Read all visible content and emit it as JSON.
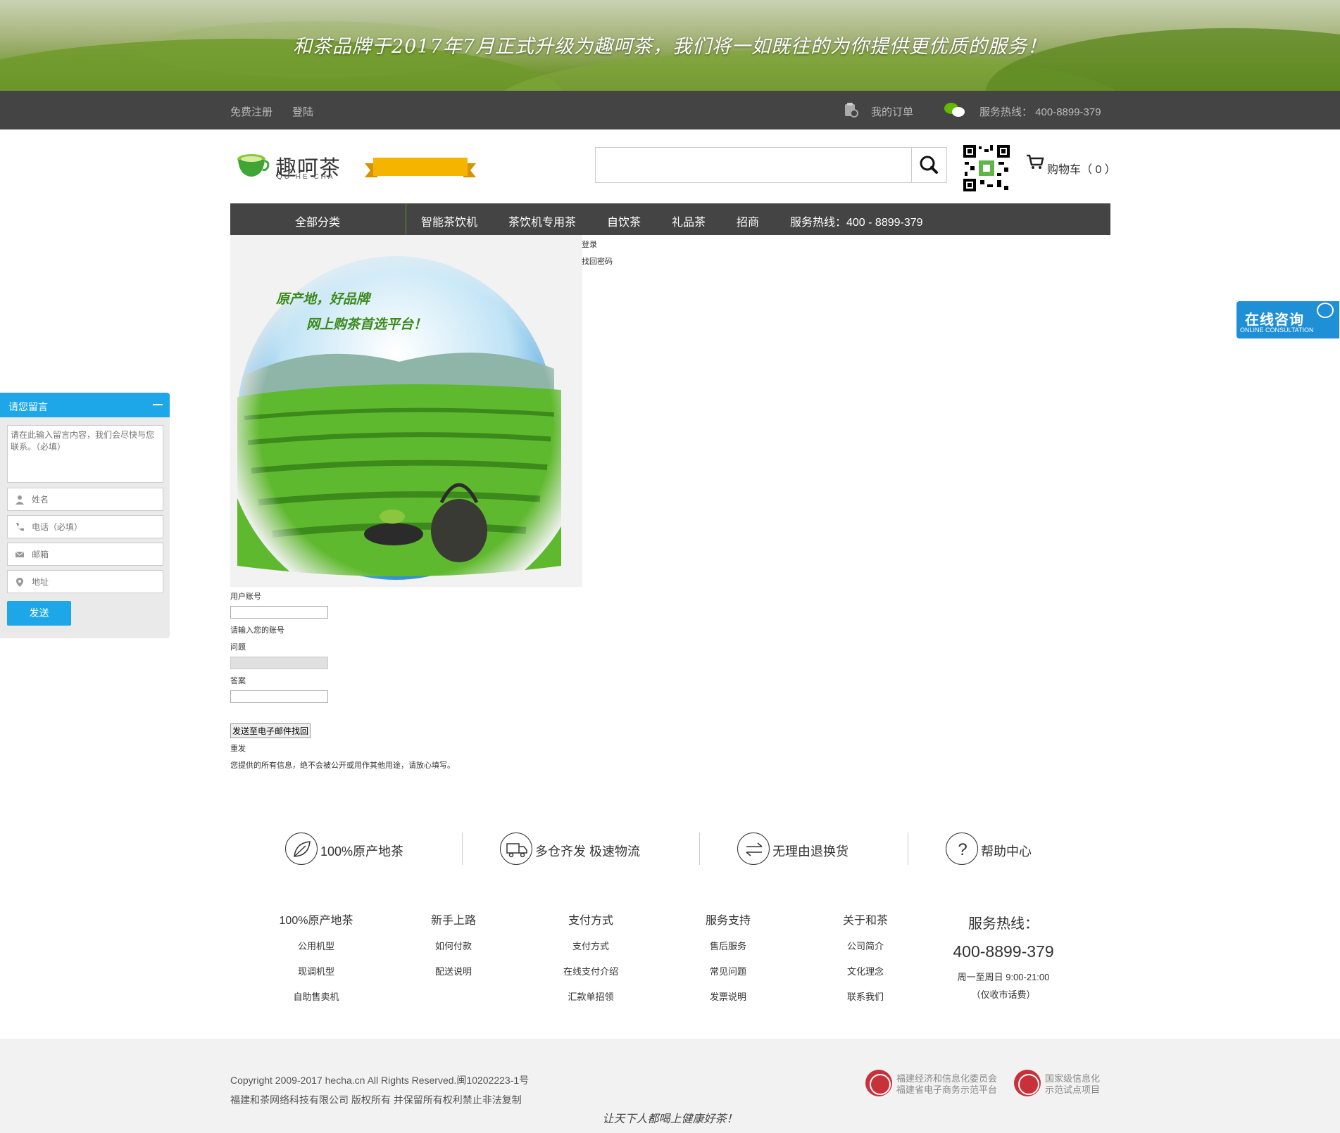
{
  "banner": {
    "slogan": "和茶品牌于2017年7月正式升级为趣呵茶，我们将一如既往的为你提供更优质的服务！"
  },
  "topbar": {
    "register": "免费注册",
    "login": "登陆",
    "my_orders": "我的订单",
    "hotline": "服务热线： 400-8899-379"
  },
  "logo": {
    "name": "趣呵茶",
    "pinyin": "QU HE CHA"
  },
  "search": {
    "placeholder": ""
  },
  "cart": {
    "label": "购物车（ 0 ）"
  },
  "nav": {
    "all": "全部分类",
    "items": [
      "智能茶饮机",
      "茶饮机专用茶",
      "自饮茶",
      "礼品茶",
      "招商",
      "服务热线：400 - 8899-379"
    ]
  },
  "hero": {
    "line1": "原产地，好品牌",
    "line2": "网上购茶首选平台！"
  },
  "login_links": {
    "login": "登录",
    "find_password": "找回密码"
  },
  "form": {
    "account_label": "用户账号",
    "account_hint": "请输入您的账号",
    "question_label": "问题",
    "answer_label": "答案",
    "send_email": "发送至电子邮件找回",
    "resend": "重发",
    "privacy": "您提供的所有信息，绝不会被公开或用作其他用途，请放心填写。"
  },
  "message_panel": {
    "title": "请您留言",
    "textarea_placeholder": "请在此输入留言内容，我们会尽快与您联系。（必填）",
    "name_placeholder": "姓名",
    "phone_placeholder": "电话（必填）",
    "email_placeholder": "邮箱",
    "address_placeholder": "地址",
    "send": "发送"
  },
  "consult": {
    "title": "在线咨询",
    "subtitle": "ONLINE CONSULTATION"
  },
  "features": [
    "100%原产地茶",
    "多仓齐发 极速物流",
    "无理由退换货",
    "帮助中心"
  ],
  "footer_columns": [
    {
      "title": "100%原产地茶",
      "links": [
        "公用机型",
        "现调机型",
        "自助售卖机"
      ]
    },
    {
      "title": "新手上路",
      "links": [
        "如何付款",
        "配送说明"
      ]
    },
    {
      "title": "支付方式",
      "links": [
        "支付方式",
        "在线支付介绍",
        "汇款单招领"
      ]
    },
    {
      "title": "服务支持",
      "links": [
        "售后服务",
        "常见问题",
        "发票说明"
      ]
    },
    {
      "title": "关于和茶",
      "links": [
        "公司简介",
        "文化理念",
        "联系我们"
      ]
    }
  ],
  "footer_hotline": {
    "title": "服务热线：",
    "number": "400-8899-379",
    "hours": "周一至周日 9:00-21:00",
    "note": "（仅收市话费）"
  },
  "copyright": {
    "line1": "Copyright 2009-2017 hecha.cn All Rights Reserved.闽10202223-1号",
    "line2": "福建和茶网络科技有限公司 版权所有 并保留所有权利禁止非法复制"
  },
  "badges": [
    {
      "line1": "福建经济和信息化委员会",
      "line2": "福建省电子商务示范平台"
    },
    {
      "line1": "国家级信息化",
      "line2": "示范试点项目"
    }
  ],
  "motto": "让天下人都喝上健康好茶！",
  "colors": {
    "accent_blue": "#1ea7e8",
    "dark_bar": "#444444",
    "ribbon": "#f5b400",
    "green": "#5a9e2a"
  }
}
